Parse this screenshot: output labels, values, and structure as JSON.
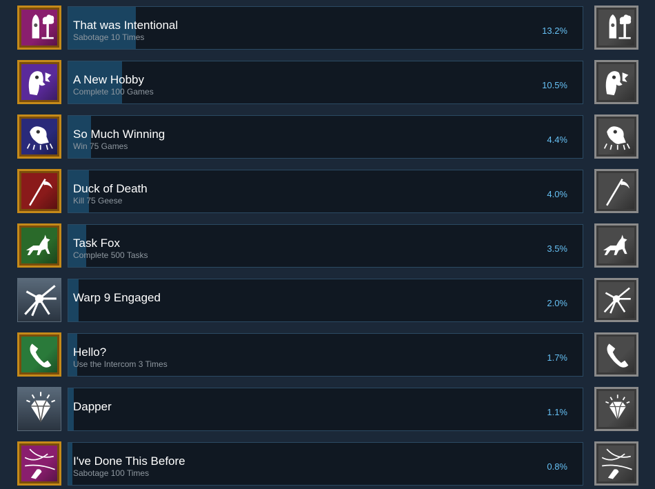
{
  "achievements": [
    {
      "name": "That was Intentional",
      "description": "Sabotage 10 Times",
      "percent_label": "13.2%",
      "percent": 13.2,
      "icon": "nuke-explosion-icon",
      "icon_bg": "#8a1e6e",
      "framed": true
    },
    {
      "name": "A New Hobby",
      "description": "Complete 100 Games",
      "percent_label": "10.5%",
      "percent": 10.5,
      "icon": "goose-head-icon",
      "icon_bg": "#5a2a9a",
      "framed": true
    },
    {
      "name": "So Much Winning",
      "description": "Win 75 Games",
      "percent_label": "4.4%",
      "percent": 4.4,
      "icon": "goose-celebrate-icon",
      "icon_bg": "#2a2a7a",
      "framed": true
    },
    {
      "name": "Duck of Death",
      "description": "Kill 75 Geese",
      "percent_label": "4.0%",
      "percent": 4.0,
      "icon": "scythe-icon",
      "icon_bg": "#8a1a1a",
      "framed": true
    },
    {
      "name": "Task Fox",
      "description": "Complete 500 Tasks",
      "percent_label": "3.5%",
      "percent": 3.5,
      "icon": "fox-icon",
      "icon_bg": "#2a6a2a",
      "framed": true
    },
    {
      "name": "Warp 9 Engaged",
      "description": "",
      "percent_label": "2.0%",
      "percent": 2.0,
      "icon": "warp-burst-icon",
      "icon_bg": "#3a4a5a",
      "framed": false
    },
    {
      "name": "Hello?",
      "description": "Use the Intercom 3 Times",
      "percent_label": "1.7%",
      "percent": 1.7,
      "icon": "phone-handset-icon",
      "icon_bg": "#2a7a3a",
      "framed": true
    },
    {
      "name": "Dapper",
      "description": "",
      "percent_label": "1.1%",
      "percent": 1.1,
      "icon": "diamond-icon",
      "icon_bg": "#3a4a5a",
      "framed": false
    },
    {
      "name": "I've Done This Before",
      "description": "Sabotage 100 Times",
      "percent_label": "0.8%",
      "percent": 0.8,
      "icon": "wire-cut-icon",
      "icon_bg": "#8a1e6e",
      "framed": true
    }
  ]
}
